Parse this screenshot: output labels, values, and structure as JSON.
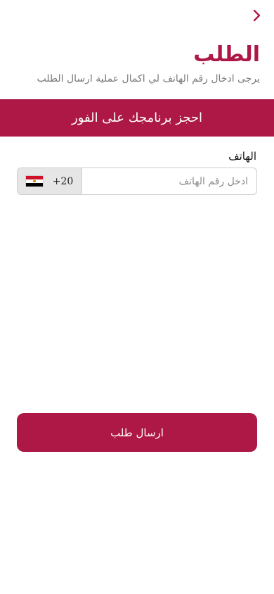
{
  "header": {
    "back_icon": "chevron-right-icon",
    "title": "الطلب",
    "subtitle": "يرجى ادخال رقم الهاتف لي اكمال عملية ارسال الطلب"
  },
  "banner": {
    "text": "احجز برنامجك على الفور"
  },
  "phone": {
    "label": "الهاتف",
    "placeholder": "ادخل رقم الهاتف",
    "value": "",
    "country_code": "+20",
    "country_flag_icon": "egypt-flag-icon"
  },
  "submit": {
    "label": "ارسال طلب"
  },
  "colors": {
    "accent": "#ad1846",
    "field_border": "#cfcfcf",
    "code_background": "#e6e6e6",
    "subtitle": "#7a7a7a"
  }
}
